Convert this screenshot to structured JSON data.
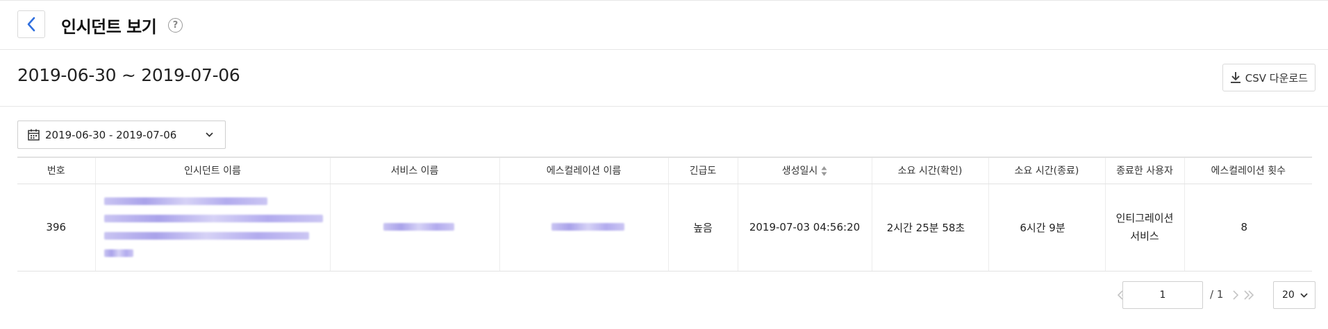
{
  "header": {
    "title": "인시던트 보기",
    "help_icon": "question-circle-icon",
    "back_icon": "chevron-left-icon"
  },
  "range": {
    "title": "2019-06-30 ~ 2019-07-06",
    "csv_label": "CSV 다운로드",
    "csv_icon": "download-icon"
  },
  "filter": {
    "date_range": "2019-06-30 - 2019-07-06",
    "calendar_icon": "calendar-icon"
  },
  "table": {
    "columns": [
      "번호",
      "인시던트 이름",
      "서비스 이름",
      "에스컬레이션 이름",
      "긴급도",
      "생성일시",
      "소요 시간(확인)",
      "소요 시간(종료)",
      "종료한 사용자",
      "에스컬레이션 횟수"
    ],
    "rows": [
      {
        "no": "396",
        "urgency": "높음",
        "created": "2019-07-03 04:56:20",
        "ack_time": "2시간 25분 58초",
        "resolve_time": "6시간 9분",
        "resolved_by": "인티그레이션 서비스",
        "escalation_count": "8"
      }
    ]
  },
  "pagination": {
    "current_page": "1",
    "total_pages": "/ 1",
    "page_size": "20"
  },
  "colors": {
    "accent": "#2f6fde",
    "border": "#e2e2e2",
    "blur": "#b3adee"
  }
}
